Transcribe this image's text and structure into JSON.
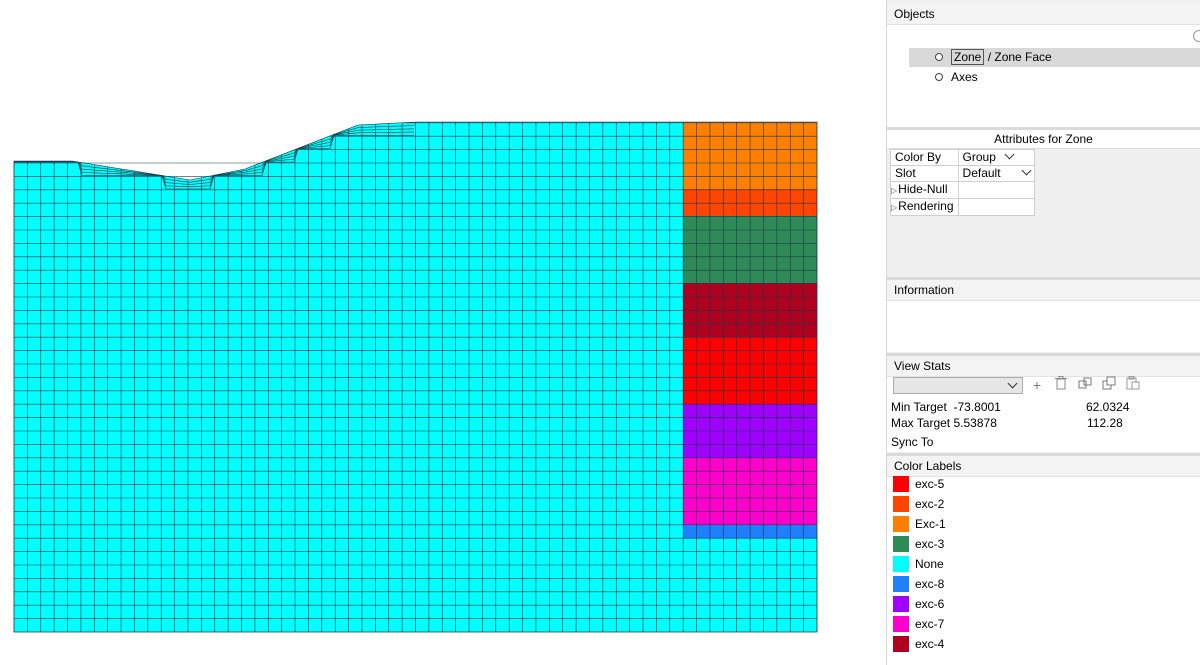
{
  "objects": {
    "title": "Objects",
    "items": [
      {
        "label_a": "Zone",
        "label_b": " / Zone Face",
        "selected": true
      },
      {
        "label_a": "Axes",
        "label_b": "",
        "selected": false
      }
    ]
  },
  "attributes": {
    "title": "Attributes for Zone",
    "rows": [
      {
        "key": "Color By",
        "value": "Group",
        "dropdown": true,
        "expandable": false
      },
      {
        "key": "Slot",
        "value": "Default",
        "dropdown": true,
        "expandable": false
      },
      {
        "key": "Hide-Null",
        "value": "",
        "dropdown": false,
        "expandable": true
      },
      {
        "key": "Rendering",
        "value": "",
        "dropdown": false,
        "expandable": true
      }
    ]
  },
  "information": {
    "title": "Information"
  },
  "view_stats": {
    "title": "View Stats",
    "min_target_label": "Min Target",
    "min_target_value": "-73.8001",
    "min_target_value2": "62.0324",
    "max_target_label": "Max Target",
    "max_target_value": "5.53878",
    "max_target_value2": "112.28",
    "sync_to": "Sync To"
  },
  "color_labels": {
    "title": "Color Labels",
    "items": [
      {
        "label": "exc-5",
        "color": "#ff0000"
      },
      {
        "label": "exc-2",
        "color": "#ff4500"
      },
      {
        "label": "Exc-1",
        "color": "#ff7f00"
      },
      {
        "label": "exc-3",
        "color": "#2e8b57"
      },
      {
        "label": "None",
        "color": "#00ffff"
      },
      {
        "label": "exc-8",
        "color": "#1e7fff"
      },
      {
        "label": "exc-6",
        "color": "#a000ff"
      },
      {
        "label": "exc-7",
        "color": "#ff00cc"
      },
      {
        "label": "exc-4",
        "color": "#b00020"
      }
    ]
  },
  "mesh": {
    "background_group": "None",
    "excavation_groups_top_to_bottom": [
      "Exc-1",
      "exc-2",
      "exc-3",
      "exc-4",
      "exc-5",
      "exc-6",
      "exc-7",
      "exc-8"
    ]
  }
}
